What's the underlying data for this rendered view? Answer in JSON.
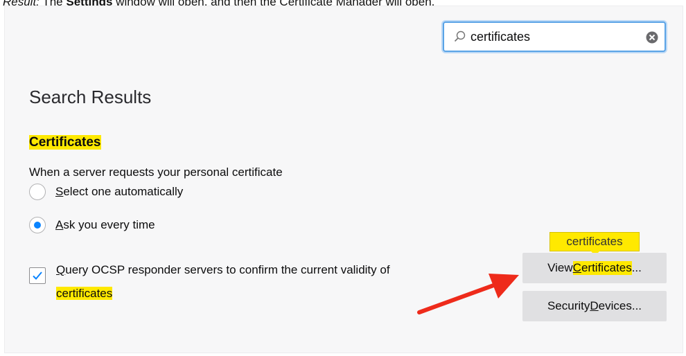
{
  "caption": {
    "lead": "Result:",
    "pre": "The",
    "bold": "Settings",
    "rest": "window will open, and then the Certificate Manager will open."
  },
  "search": {
    "value": "certificates",
    "icon": "search-icon",
    "clear_icon": "clear-icon"
  },
  "results_title": "Search Results",
  "section": {
    "title": "Certificates",
    "description": "When a server requests your personal certificate",
    "options": [
      {
        "access_key": "S",
        "label_rest": "elect one automatically",
        "checked": false
      },
      {
        "access_key": "A",
        "label_rest": "sk you every time",
        "checked": true
      }
    ],
    "ocsp": {
      "access_key": "Q",
      "label_rest": "uery OCSP responder servers to confirm the current validity of",
      "label_tail": "certificates",
      "checked": true
    }
  },
  "tooltip": "certificates",
  "buttons": {
    "view": {
      "pre": "View ",
      "key": "C",
      "rest": "ertificates",
      "ellipsis": "..."
    },
    "devices": {
      "pre": "Security ",
      "key": "D",
      "rest": "evices..."
    }
  },
  "colors": {
    "highlight": "#ffe900",
    "accent": "#0a84ff",
    "arrow": "#ee2b1b"
  }
}
